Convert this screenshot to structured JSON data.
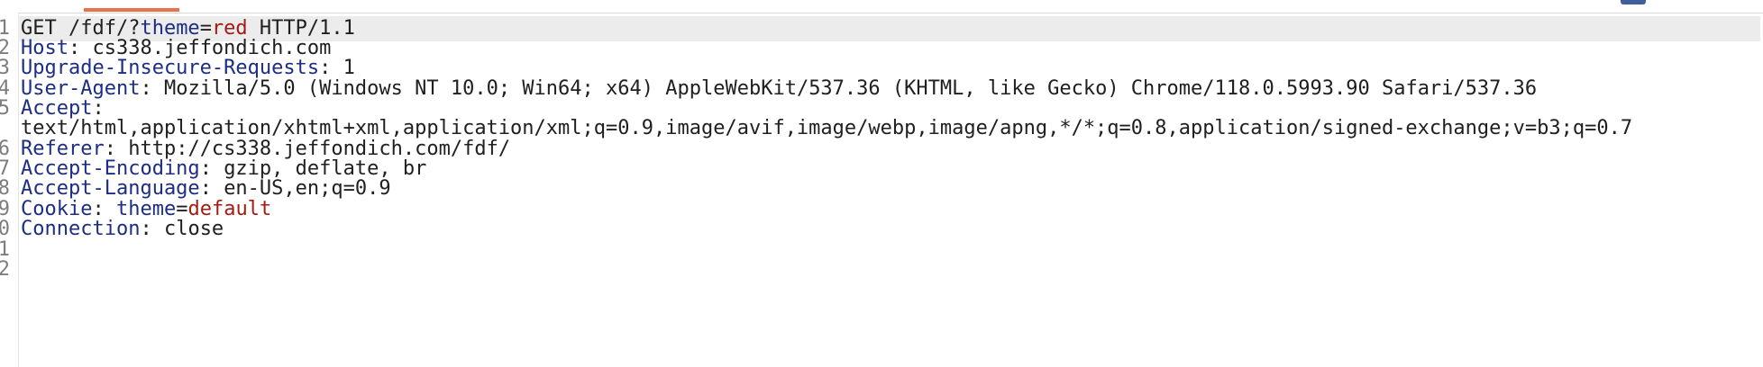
{
  "line_numbers": [
    "1",
    "2",
    "3",
    "4",
    "5",
    "6",
    "7",
    "8",
    "9",
    "0",
    "1",
    "2"
  ],
  "request": {
    "request_line": {
      "method_path": "GET /fdf/?",
      "param_name": "theme",
      "equals": "=",
      "param_value": "red",
      "protocol": " HTTP/1.1"
    },
    "headers": [
      {
        "name": "Host",
        "separator": ": ",
        "value": "cs338.jeffondich.com"
      },
      {
        "name": "Upgrade-Insecure-Requests",
        "separator": ": ",
        "value": "1"
      },
      {
        "name": "User-Agent",
        "separator": ": ",
        "value": "Mozilla/5.0 (Windows NT 10.0; Win64; x64) AppleWebKit/537.36 (KHTML, like Gecko) Chrome/118.0.5993.90 Safari/537.36"
      },
      {
        "name": "Accept",
        "separator": ":",
        "value": "text/html,application/xhtml+xml,application/xml;q=0.9,image/avif,image/webp,image/apng,*/*;q=0.8,application/signed-exchange;v=b3;q=0.7"
      },
      {
        "name": "Referer",
        "separator": ": ",
        "value": "http://cs338.jeffondich.com/fdf/"
      },
      {
        "name": "Accept-Encoding",
        "separator": ": ",
        "value": "gzip, deflate, br"
      },
      {
        "name": "Accept-Language",
        "separator": ": ",
        "value": "en-US,en;q=0.9"
      }
    ],
    "cookie": {
      "name": "Cookie",
      "separator": ": ",
      "cookie_name": "theme",
      "equals": "=",
      "cookie_value": "default"
    },
    "connection": {
      "name": "Connection",
      "separator": ": ",
      "value": "close"
    }
  },
  "colors": {
    "header_name": "#1c2d86",
    "value_highlight": "#a31b12",
    "plain_text": "#202020",
    "current_line_bg": "#ececec",
    "active_tab_accent": "#e8734a"
  }
}
